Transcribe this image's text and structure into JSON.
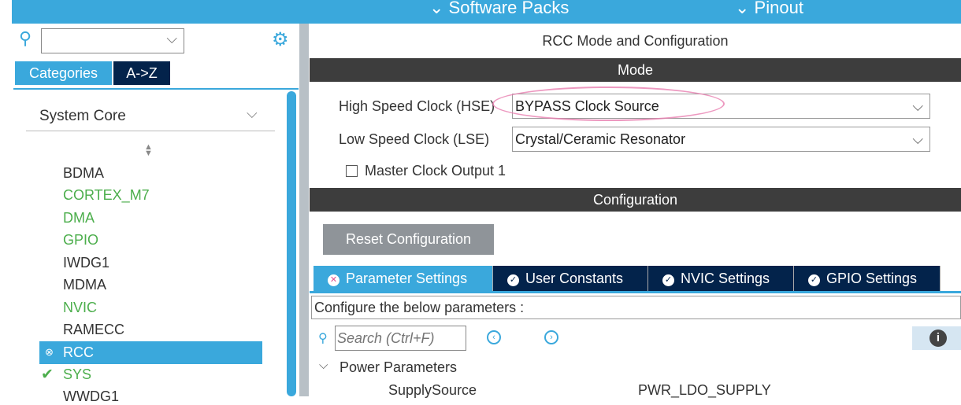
{
  "topbar": {
    "software_packs": "Software Packs",
    "pinout": "Pinout"
  },
  "sidebar": {
    "tabs": [
      "Categories",
      "A->Z"
    ],
    "category": "System Core",
    "items": [
      {
        "label": "BDMA",
        "state": "none"
      },
      {
        "label": "CORTEX_M7",
        "state": "green"
      },
      {
        "label": "DMA",
        "state": "green"
      },
      {
        "label": "GPIO",
        "state": "green"
      },
      {
        "label": "IWDG1",
        "state": "none"
      },
      {
        "label": "MDMA",
        "state": "none"
      },
      {
        "label": "NVIC",
        "state": "green"
      },
      {
        "label": "RAMECC",
        "state": "none"
      },
      {
        "label": "RCC",
        "state": "error-selected"
      },
      {
        "label": "SYS",
        "state": "ok"
      },
      {
        "label": "WWDG1",
        "state": "none"
      }
    ]
  },
  "main": {
    "title": "RCC Mode and Configuration",
    "mode_header": "Mode",
    "hse_label": "High Speed Clock (HSE)",
    "hse_value": "BYPASS Clock Source",
    "lse_label": "Low Speed Clock (LSE)",
    "lse_value": "Crystal/Ceramic Resonator",
    "mco_label": "Master Clock Output 1",
    "config_header": "Configuration",
    "reset_button": "Reset Configuration",
    "tabs": [
      "Parameter Settings",
      "User Constants",
      "NVIC Settings",
      "GPIO Settings"
    ],
    "configure_text": "Configure the below parameters :",
    "search_placeholder": "Search (Ctrl+F)",
    "group": "Power Parameters",
    "param_name": "SupplySource",
    "param_value": "PWR_LDO_SUPPLY"
  },
  "colors": {
    "accent": "#3aa8dc",
    "dark_tab": "#03234b",
    "green": "#4cae4c",
    "highlight": "#e87fb0"
  }
}
